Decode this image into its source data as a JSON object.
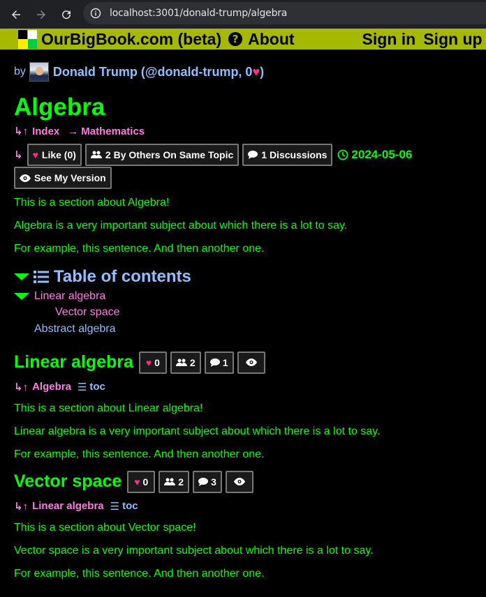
{
  "browser": {
    "url": "localhost:3001/donald-trump/algebra"
  },
  "header": {
    "site_title": "OurBigBook.com (beta)",
    "about": "About",
    "sign_in": "Sign in",
    "sign_up": "Sign up"
  },
  "colors": {
    "header_bg": "#a7b800",
    "text_green": "#00ff00",
    "link_pink": "#ff7ce6",
    "link_blue": "#8fbfff",
    "heart": "#ff2d8a"
  },
  "byline": {
    "by": "by",
    "author": "Donald Trump (@donald-trump, 0",
    "close": ")"
  },
  "article": {
    "title": "Algebra",
    "nav_index": "Index",
    "nav_parent": "Mathematics",
    "like_label": "Like (0)",
    "others_label": "2 By Others On Same Topic",
    "discussions_label": "1 Discussions",
    "date": "2024-05-06",
    "see_version": "See My Version",
    "paragraphs": [
      "This is a section about Algebra!",
      "Algebra is a very important subject about which there is a lot to say.",
      "For example, this sentence. And then another one."
    ]
  },
  "toc": {
    "title": "Table of contents",
    "items": [
      "Linear algebra",
      "Vector space",
      "Abstract algebra"
    ]
  },
  "sections": [
    {
      "title": "Linear algebra",
      "likes": "0",
      "others": "2",
      "discussions": "1",
      "parent": "Algebra",
      "toc": "toc",
      "paragraphs": [
        "This is a section about Linear algebra!",
        "Linear algebra is a very important subject about which there is a lot to say.",
        "For example, this sentence. And then another one."
      ]
    },
    {
      "title": "Vector space",
      "likes": "0",
      "others": "2",
      "discussions": "3",
      "parent": "Linear algebra",
      "toc": "toc",
      "paragraphs": [
        "This is a section about Vector space!",
        "Vector space is a very important subject about which there is a lot to say.",
        "For example, this sentence. And then another one."
      ]
    }
  ]
}
